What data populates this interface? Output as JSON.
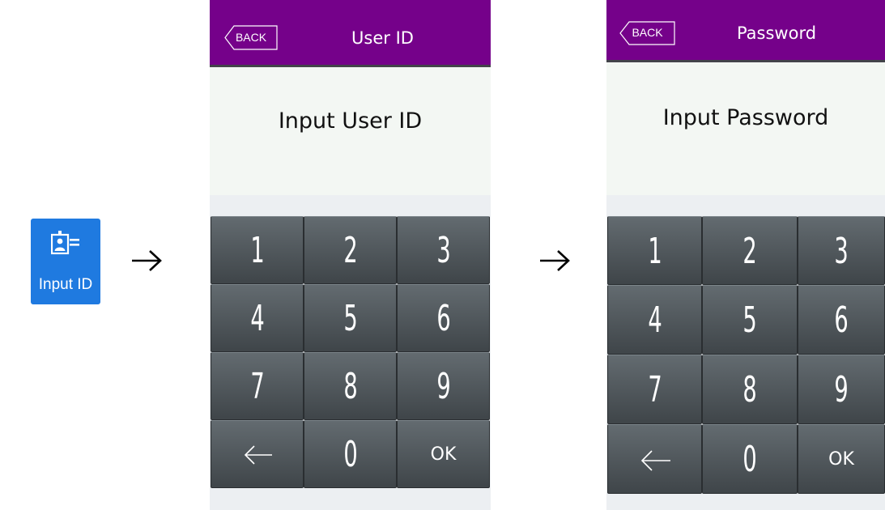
{
  "launcher": {
    "icon": "id-card-icon",
    "label": "Input ID"
  },
  "arrows": [
    "right-arrow-icon",
    "right-arrow-icon"
  ],
  "screens": [
    {
      "back_label": "BACK",
      "title": "User ID",
      "prompt": "Input User ID",
      "keys": [
        "1",
        "2",
        "3",
        "4",
        "5",
        "6",
        "7",
        "8",
        "9",
        "←",
        "0",
        "OK"
      ]
    },
    {
      "back_label": "BACK",
      "title": "Password",
      "prompt": "Input Password",
      "keys": [
        "1",
        "2",
        "3",
        "4",
        "5",
        "6",
        "7",
        "8",
        "9",
        "←",
        "0",
        "OK"
      ]
    }
  ],
  "colors": {
    "title_bar": "#75018a",
    "launcher_tile": "#1f7ae0",
    "key_top": "#636b70",
    "key_bottom": "#3f4549",
    "prompt_bg": "#f3f7f3"
  }
}
